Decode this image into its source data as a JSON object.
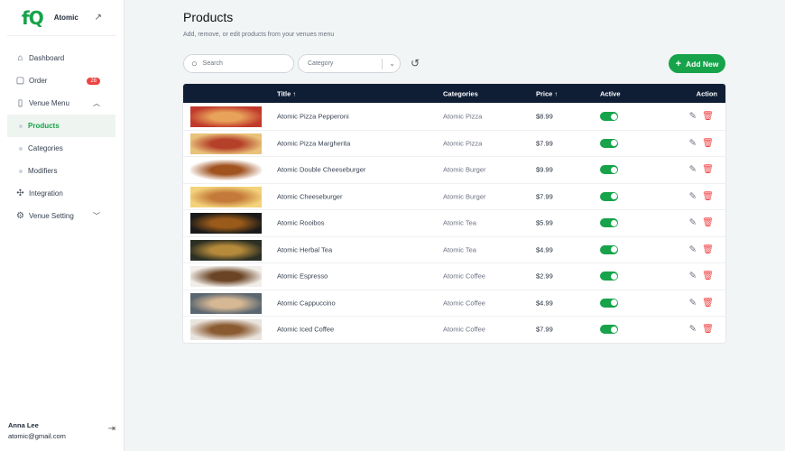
{
  "brand": {
    "logo": "fQ",
    "name": "Atomic"
  },
  "nav": [
    {
      "label": "Dashboard",
      "icon": "home-icon"
    },
    {
      "label": "Order",
      "icon": "bag-icon",
      "badge": "28"
    },
    {
      "label": "Venue Menu",
      "icon": "book-icon"
    },
    {
      "label": "Products",
      "sub": true,
      "active": true
    },
    {
      "label": "Categories",
      "sub": true
    },
    {
      "label": "Modifiers",
      "sub": true
    },
    {
      "label": "Integration",
      "icon": "puzzle-icon"
    },
    {
      "label": "Venue Setting",
      "icon": "gear-icon"
    }
  ],
  "user": {
    "name": "Anna Lee",
    "email": "atomic@gmail.com"
  },
  "page": {
    "title": "Products",
    "subtitle": "Add, remove, or edit products from your venues menu"
  },
  "toolbar": {
    "search_placeholder": "Search",
    "category_placeholder": "Category",
    "add_label": "Add New"
  },
  "table": {
    "headers": {
      "title": "Title ↑",
      "categories": "Categories",
      "price": "Price ↑",
      "active": "Active",
      "action": "Action"
    },
    "rows": [
      {
        "title": "Atomic Pizza Pepperoni",
        "category": "Atomic Pizza",
        "price": "$8.99",
        "active": true,
        "img": [
          "#c0392b",
          "#e8a25a"
        ]
      },
      {
        "title": "Atomic Pizza Margherita",
        "category": "Atomic Pizza",
        "price": "$7.99",
        "active": true,
        "img": [
          "#e9c27a",
          "#b5402a"
        ]
      },
      {
        "title": "Atomic Double Cheeseburger",
        "category": "Atomic Burger",
        "price": "$9.99",
        "active": true,
        "img": [
          "#ffffff",
          "#a0521f"
        ]
      },
      {
        "title": "Atomic Cheeseburger",
        "category": "Atomic Burger",
        "price": "$7.99",
        "active": true,
        "img": [
          "#f3d27a",
          "#c47a3a"
        ]
      },
      {
        "title": "Atomic Rooibos",
        "category": "Atomic Tea",
        "price": "$5.99",
        "active": true,
        "img": [
          "#1a1a1a",
          "#9a5a1a"
        ]
      },
      {
        "title": "Atomic Herbal Tea",
        "category": "Atomic Tea",
        "price": "$4.99",
        "active": true,
        "img": [
          "#2b2f24",
          "#b58a3a"
        ]
      },
      {
        "title": "Atomic Espresso",
        "category": "Atomic Coffee",
        "price": "$2.99",
        "active": true,
        "img": [
          "#f1eee9",
          "#6b4425"
        ]
      },
      {
        "title": "Atomic Cappuccino",
        "category": "Atomic Coffee",
        "price": "$4.99",
        "active": true,
        "img": [
          "#5a6670",
          "#d7b894"
        ]
      },
      {
        "title": "Atomic Iced Coffee",
        "category": "Atomic Coffee",
        "price": "$7.99",
        "active": true,
        "img": [
          "#e9e4de",
          "#8a5a30"
        ]
      }
    ]
  }
}
